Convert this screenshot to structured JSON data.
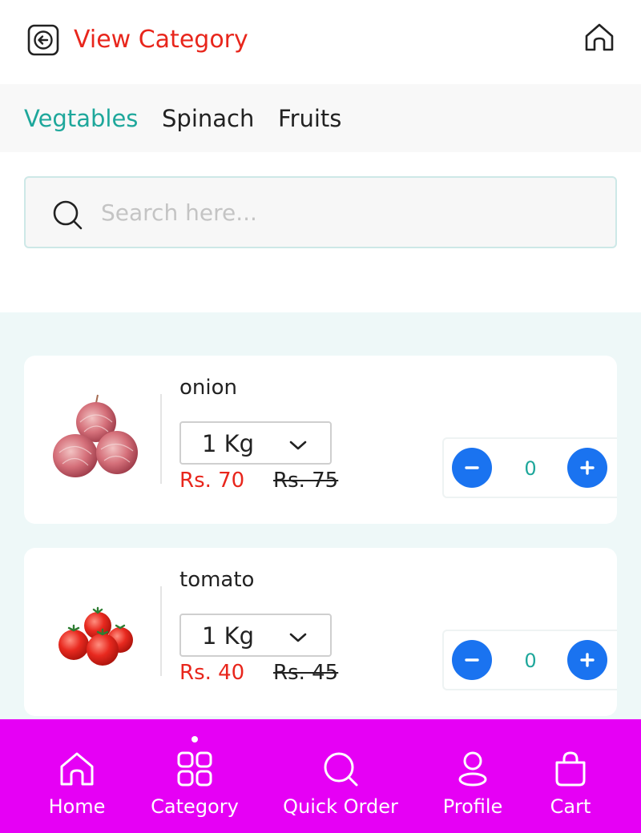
{
  "header": {
    "title": "View Category",
    "back_icon": "back-arrow-icon",
    "home_icon": "home-icon"
  },
  "tabs": [
    {
      "label": "Vegtables",
      "active": true
    },
    {
      "label": "Spinach",
      "active": false
    },
    {
      "label": "Fruits",
      "active": false
    }
  ],
  "search": {
    "placeholder": "Search here...",
    "value": ""
  },
  "products": [
    {
      "name": "onion",
      "unit": "1 Kg",
      "price": "Rs. 70",
      "mrp": "Rs. 75",
      "quantity": "0",
      "image": "onion-image"
    },
    {
      "name": "tomato",
      "unit": "1 Kg",
      "price": "Rs. 40",
      "mrp": "Rs. 45",
      "quantity": "0",
      "image": "tomato-image"
    }
  ],
  "bottom_nav": {
    "items": [
      {
        "label": "Home",
        "icon": "home-icon"
      },
      {
        "label": "Category",
        "icon": "grid-icon",
        "active": true
      },
      {
        "label": "Quick Order",
        "icon": "search-icon"
      },
      {
        "label": "Profile",
        "icon": "user-icon"
      },
      {
        "label": "Cart",
        "icon": "shopping-bag-icon"
      }
    ]
  },
  "colors": {
    "accent_red": "#e8261c",
    "accent_teal": "#1ea79b",
    "button_blue": "#1a73f0",
    "nav_background": "#e600f5",
    "list_background": "#eef8f8"
  }
}
